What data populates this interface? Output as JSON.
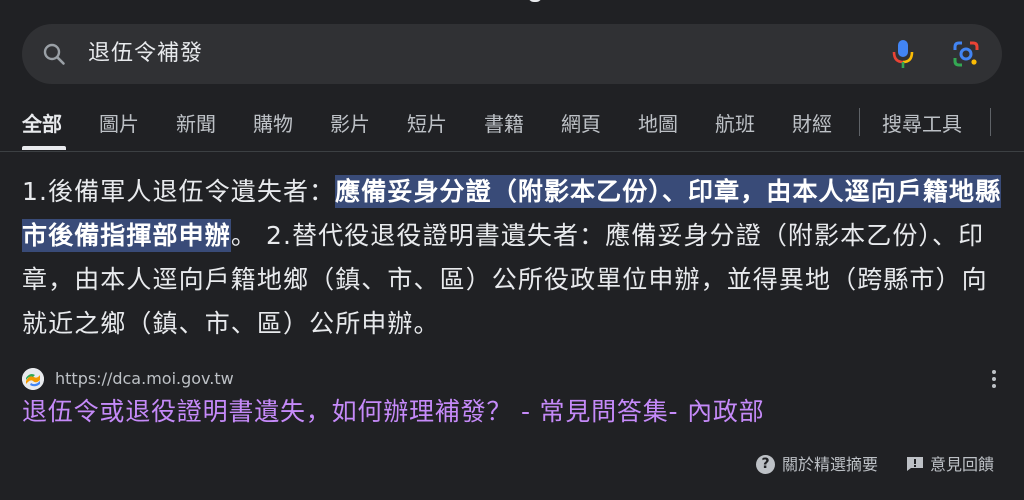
{
  "search": {
    "query": "退伍令補發"
  },
  "tabs": [
    {
      "label": "全部",
      "active": true
    },
    {
      "label": "圖片"
    },
    {
      "label": "新聞"
    },
    {
      "label": "購物"
    },
    {
      "label": "影片"
    },
    {
      "label": "短片"
    },
    {
      "label": "書籍"
    },
    {
      "label": "網頁"
    },
    {
      "label": "地圖"
    },
    {
      "label": "航班"
    },
    {
      "label": "財經"
    },
    {
      "label": "搜尋工具"
    }
  ],
  "snippet": {
    "part1": "1.後備軍人退伍令遺失者：",
    "highlight": "應備妥身分證（附影本乙份）、印章，由本人逕向戶籍地縣市後備指揮部申辦",
    "part2": "。 2.替代役退役證明書遺失者：應備妥身分證（附影本乙份）、印章，由本人逕向戶籍地鄉（鎮、市、區）公所役政單位申辦，並得異地（跨縣市）向就近之鄉（鎮、市、區）公所申辦。"
  },
  "result": {
    "url": "https://dca.moi.gov.tw",
    "title": "退伍令或退役證明書遺失，如何辦理補發？ - 常見問答集- 內政部"
  },
  "footer": {
    "about_label": "關於精選摘要",
    "feedback_label": "意見回饋"
  },
  "colors": {
    "background": "#202124",
    "search_bar": "#303134",
    "highlight": "#394b78",
    "link_visited": "#c58af9"
  }
}
